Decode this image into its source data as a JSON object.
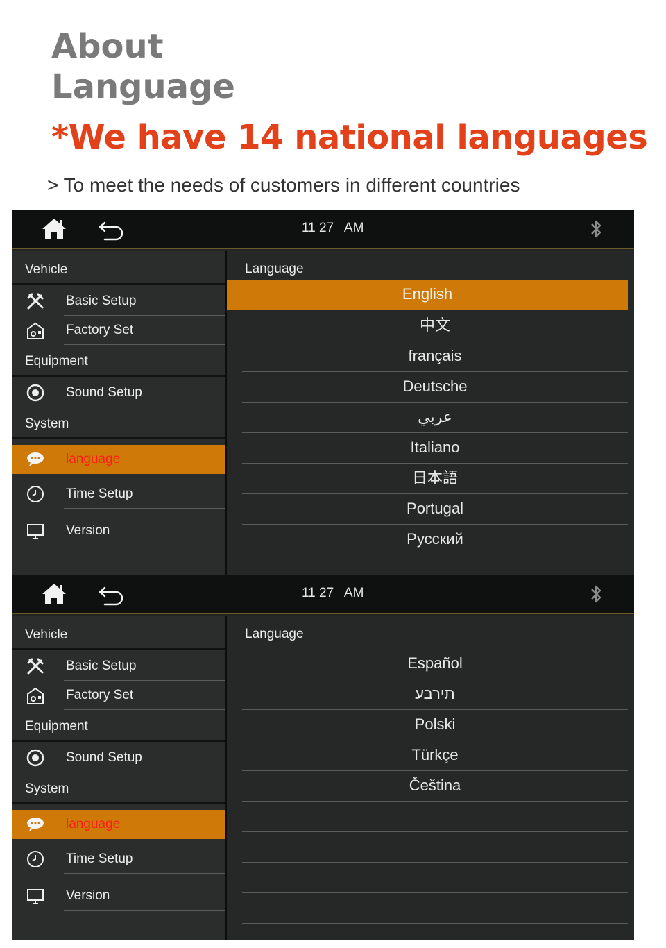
{
  "header": {
    "title_line1": "About",
    "title_line2": "Language",
    "headline": "*We have 14 national languages",
    "subtitle": "> To meet the needs of customers in different countries"
  },
  "colors": {
    "accent_orange": "#cf7a08",
    "headline_red": "#e2411a",
    "active_label_red": "#ff1a1a"
  },
  "screens": [
    {
      "topbar": {
        "home_icon": "home-icon",
        "back_icon": "back-arrow-icon",
        "time": "11 27   AM",
        "bluetooth_icon": "bluetooth-icon"
      },
      "sidebar": {
        "sections": [
          "Vehicle",
          "Equipment",
          "System"
        ],
        "items": [
          "Basic Setup",
          "Factory Set",
          "Sound Setup",
          "language",
          "Time Setup",
          "Version"
        ],
        "active": "language"
      },
      "content": {
        "heading": "Language",
        "languages": [
          "English",
          "中文",
          "français",
          "Deutsche",
          "عربي",
          "Italiano",
          "日本語",
          "Portugal",
          "Русский"
        ],
        "selected": "English"
      }
    },
    {
      "topbar": {
        "home_icon": "home-icon",
        "back_icon": "back-arrow-icon",
        "time": "11 27   AM",
        "bluetooth_icon": "bluetooth-icon"
      },
      "sidebar": {
        "sections": [
          "Vehicle",
          "Equipment",
          "System"
        ],
        "items": [
          "Basic Setup",
          "Factory Set",
          "Sound Setup",
          "language",
          "Time Setup",
          "Version"
        ],
        "active": "language"
      },
      "content": {
        "heading": "Language",
        "languages": [
          "Español",
          "תירבע",
          "Polski",
          "Türkçe",
          "Čeština"
        ]
      }
    }
  ]
}
